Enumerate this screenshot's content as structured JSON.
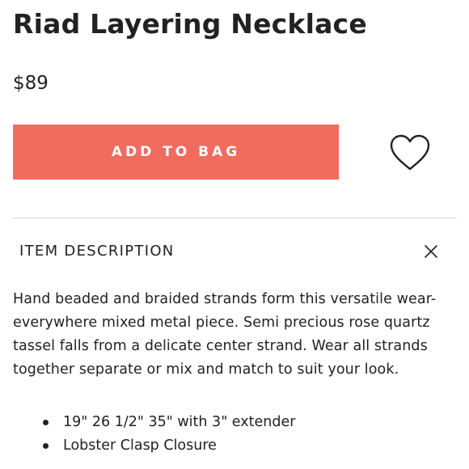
{
  "product": {
    "title": "Riad Layering Necklace",
    "price": "$89"
  },
  "actions": {
    "add_to_bag_label": "ADD TO BAG",
    "favorite_icon": "heart-outline-icon"
  },
  "colors": {
    "accent": "#f26b5f",
    "text": "#222222",
    "divider": "#d9d9d9"
  },
  "description_section": {
    "header": "ITEM DESCRIPTION",
    "close_icon": "close-icon",
    "body": "Hand beaded and braided strands form this versatile wear-everywhere mixed metal piece. Semi precious rose quartz tassel falls from a delicate center strand. Wear all strands together separate or mix and match to suit your look.",
    "bullets": [
      "19\" 26 1/2\" 35\" with 3\" extender",
      "Lobster Clasp Closure"
    ]
  }
}
